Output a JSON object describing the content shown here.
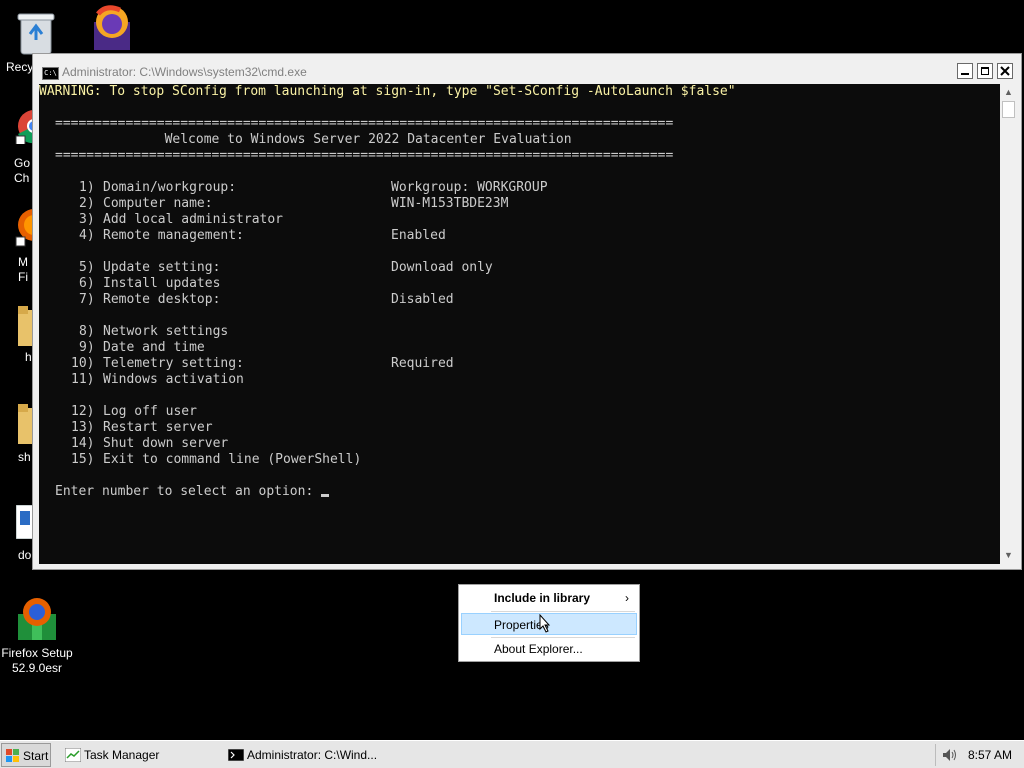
{
  "desktop": {
    "icons": [
      {
        "label": "Recy",
        "icon": "recycle-bin-icon"
      },
      {
        "label": "",
        "icon": "firefox-installer-icon"
      },
      {
        "label": "Go\nCh",
        "icon": "chrome-icon"
      },
      {
        "label": "M\nFi",
        "icon": "firefox-icon"
      },
      {
        "label": "h",
        "icon": "folder-icon"
      },
      {
        "label": "sh",
        "icon": "folder-icon"
      },
      {
        "label": "do",
        "icon": "document-icon"
      },
      {
        "label": "Firefox Setup\n52.9.0esr",
        "icon": "firefox-setup-icon"
      }
    ]
  },
  "window": {
    "title": "Administrator: C:\\Windows\\system32\\cmd.exe",
    "icon_text": "C:\\"
  },
  "console": {
    "warning": "WARNING: To stop SConfig from launching at sign-in, type \"Set-SConfig -AutoLaunch $false\"",
    "rule": "===============================================================================",
    "heading": "              Welcome to Windows Server 2022 Datacenter Evaluation",
    "menu": [
      {
        "num": "1)",
        "label": "Domain/workgroup:",
        "value": "Workgroup: WORKGROUP"
      },
      {
        "num": "2)",
        "label": "Computer name:",
        "value": "WIN-M153TBDE23M"
      },
      {
        "num": "3)",
        "label": "Add local administrator",
        "value": ""
      },
      {
        "num": "4)",
        "label": "Remote management:",
        "value": "Enabled"
      },
      {
        "num": "5)",
        "label": "Update setting:",
        "value": "Download only"
      },
      {
        "num": "6)",
        "label": "Install updates",
        "value": ""
      },
      {
        "num": "7)",
        "label": "Remote desktop:",
        "value": "Disabled"
      },
      {
        "num": "8)",
        "label": "Network settings",
        "value": ""
      },
      {
        "num": "9)",
        "label": "Date and time",
        "value": ""
      },
      {
        "num": "10)",
        "label": "Telemetry setting:",
        "value": "Required"
      },
      {
        "num": "11)",
        "label": "Windows activation",
        "value": ""
      },
      {
        "num": "12)",
        "label": "Log off user",
        "value": ""
      },
      {
        "num": "13)",
        "label": "Restart server",
        "value": ""
      },
      {
        "num": "14)",
        "label": "Shut down server",
        "value": ""
      },
      {
        "num": "15)",
        "label": "Exit to command line (PowerShell)",
        "value": ""
      }
    ],
    "prompt": "Enter number to select an option: "
  },
  "context_menu": {
    "items": [
      {
        "label": "Include in library",
        "has_submenu": true
      },
      {
        "label": "Properties"
      },
      {
        "label": "About Explorer..."
      }
    ]
  },
  "taskbar": {
    "start_label": "Start",
    "tasks": [
      {
        "label": "Task Manager",
        "icon": "task-manager-icon"
      },
      {
        "label": "Administrator: C:\\Wind...",
        "icon": "cmd-icon"
      }
    ],
    "clock": "8:57 AM"
  }
}
